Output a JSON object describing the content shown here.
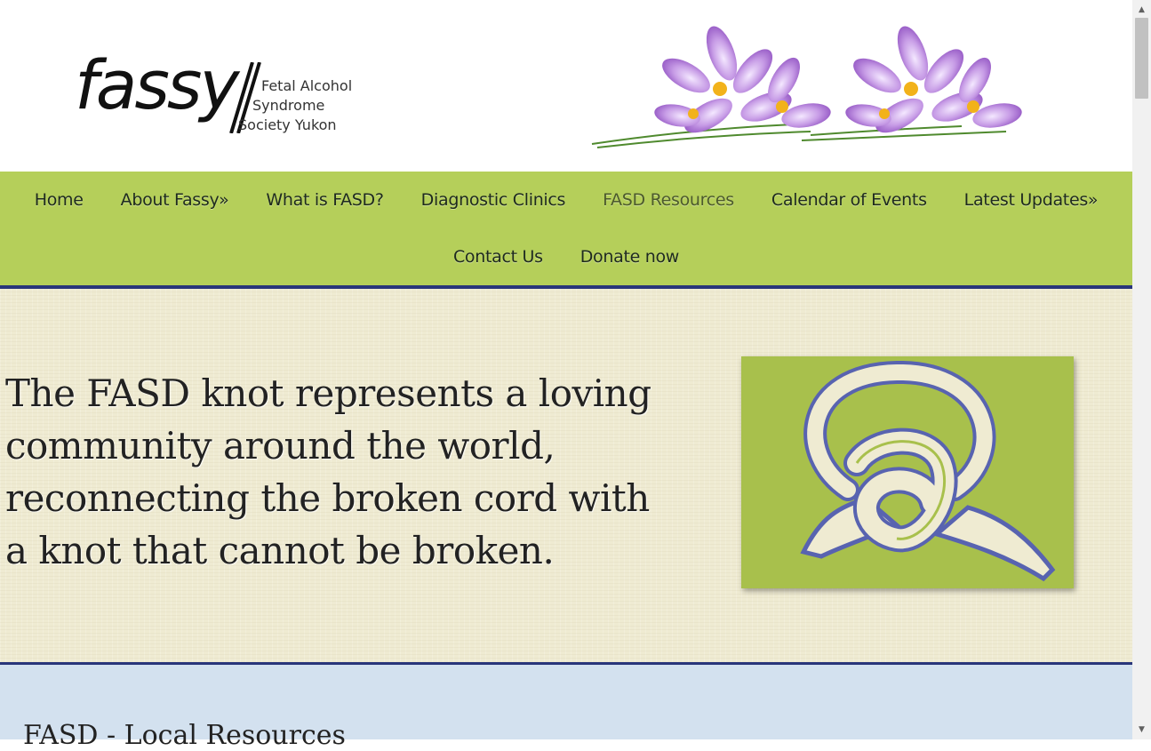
{
  "logo": {
    "word": "fassy",
    "lines": [
      "Fetal Alcohol",
      "Syndrome",
      "Society Yukon"
    ]
  },
  "nav": {
    "row1": [
      "Home",
      "About Fassy»",
      "What is FASD?",
      "Diagnostic Clinics",
      "FASD Resources",
      "Calendar of Events",
      "Latest Updates»"
    ],
    "row2": [
      "Contact Us",
      "Donate now"
    ],
    "active": "FASD Resources"
  },
  "hero": {
    "text": "The FASD knot represents a loving community around the world, reconnecting the broken cord with a knot that cannot be broken."
  },
  "section": {
    "title": "FASD - Local Resources"
  },
  "colors": {
    "nav_bg": "#b5cf5a",
    "nav_border": "#28357a",
    "hero_bg": "#efebd2",
    "knot_bg": "#a8c04c",
    "knot_outline": "#5863b0",
    "lower_bg": "#d3e1ef"
  },
  "icons": {
    "scroll_up": "triangle-up-icon",
    "scroll_down": "triangle-down-icon"
  }
}
